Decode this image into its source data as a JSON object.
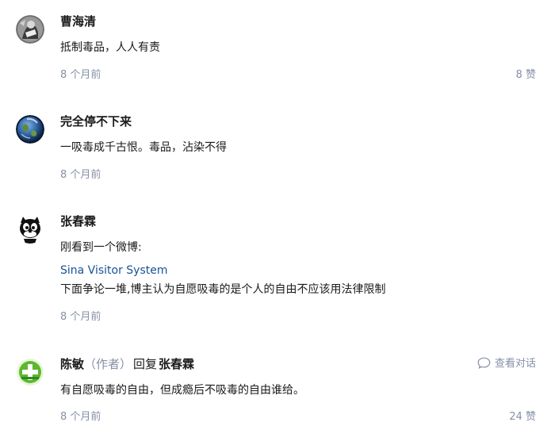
{
  "comments": [
    {
      "author": "曹海清",
      "avatar_icon": "bw-photo-avatar",
      "content": "抵制毒品，人人有责",
      "time": "8 个月前",
      "likes": "8 赞"
    },
    {
      "author": "完全停不下来",
      "avatar_icon": "earth-avatar",
      "content": "一吸毒成千古恨。毒品，沾染不得",
      "time": "8 个月前"
    },
    {
      "author": "张春霖",
      "avatar_icon": "cartoon-cat-avatar",
      "content_line1": "刚看到一个微博:",
      "link": "Sina Visitor System",
      "content_line2": "下面争论一堆,博主认为自愿吸毒的是个人的自由不应该用法律限制",
      "time": "8 个月前"
    },
    {
      "author": "陈敏",
      "role": "（作者）",
      "reply_word": "回复",
      "reply_to": "张春霖",
      "avatar_icon": "green-plus-avatar",
      "view_conversation": "查看对话",
      "content": "有自愿吸毒的自由，但成瘾后不吸毒的自由谁给。",
      "time": "8 个月前",
      "likes": "24 赞"
    }
  ]
}
